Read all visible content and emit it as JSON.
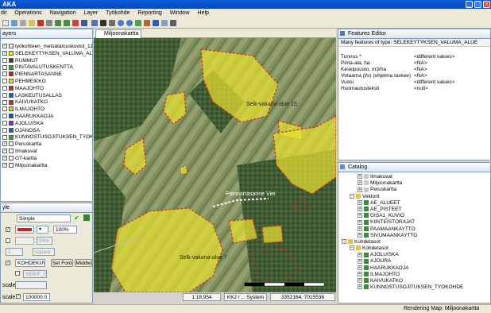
{
  "window": {
    "title": "AKA",
    "min": "_",
    "max": "□",
    "close": "x"
  },
  "menu": [
    "dit",
    "Operations",
    "Navigation",
    "Layer",
    "Työkohde",
    "Reporting",
    "Window",
    "Help"
  ],
  "layers_panel": {
    "title": "ayers",
    "items": [
      {
        "label": "työkohteen_metsätalouskuviot_119073",
        "color": "#f4f4f4",
        "checked": true
      },
      {
        "label": "SELEKEYTYKSEN_VALUMA_ALUE",
        "color": "#f0f000",
        "checked": true
      },
      {
        "label": "RUMMUT",
        "color": "#3a3a3a",
        "checked": false
      },
      {
        "label": "PINTAVALUTUSKENTTA",
        "color": "#28a828",
        "checked": false
      },
      {
        "label": "PIENNARTASANNE",
        "color": "#c02020",
        "checked": false
      },
      {
        "label": "PEHMEIKKO",
        "color": "#e8e020",
        "checked": false
      },
      {
        "label": "MAAJOHTO",
        "color": "#e02020",
        "checked": false
      },
      {
        "label": "LASKEUTUSALLAS",
        "color": "#1060c8",
        "checked": false
      },
      {
        "label": "KAIVUKATKO",
        "color": "#d82020",
        "checked": false
      },
      {
        "label": "ILMAJOHTO",
        "color": "#d8d020",
        "checked": false
      },
      {
        "label": "HAARUKKAOJA",
        "color": "#2040d0",
        "checked": false
      },
      {
        "label": "AJOLUISKA",
        "color": "#8030c0",
        "checked": false
      },
      {
        "label": "OJANOSA",
        "color": "#2050e0",
        "checked": false
      },
      {
        "label": "KUNNOSTUSOJITUKSEN_TYOKOHDE",
        "color": "#40a040",
        "checked": false
      },
      {
        "label": "Peruskartta",
        "color": "#ffffff",
        "checked": true
      },
      {
        "label": "Ilmakuvat",
        "color": "#ffffff",
        "checked": true
      },
      {
        "label": "GT-kartta",
        "color": "#ffffff",
        "checked": true
      },
      {
        "label": "Miljoonakartta",
        "color": "#ffffff",
        "checked": true
      }
    ]
  },
  "style_panel": {
    "title": "yle",
    "style_select": "Simple",
    "fill_opacity": "100%",
    "stroke_opacity": "50%",
    "stroke_width": "1",
    "square_select": "square",
    "label_field": "KOHDEKUVAL",
    "set_font": "Set Font",
    "middle": "Middle",
    "font_field": "SERIF_0",
    "scale_label_1": "scale:",
    "scale_label_2": "scale:",
    "max_scale": "100000.0"
  },
  "map_tab": {
    "title": "Miljoonakartta"
  },
  "map_labels": {
    "area_1": "Selk-valuma-alue 15",
    "area_2": "Piennartasanne Viei",
    "area_3": "Selk-valuma-alue 7"
  },
  "map_status": {
    "scale": "1:18,954",
    "crs": "KKJ / ... System",
    "coords": "3352164, 7015536"
  },
  "features_panel": {
    "title": "Features Editor",
    "subtitle": "Many features of type: SELEKEYTYKSEN_VALUMA_ALUE",
    "rows": [
      {
        "key": "Tunnus *",
        "value": "<different values>"
      },
      {
        "key": "Pinta-ala, ha",
        "value": "<NA>"
      },
      {
        "key": "Keskipuusto, m3/ha",
        "value": "<NA>"
      },
      {
        "key": "Virtaama (l/s) (ohjelma laskee)",
        "value": "<NA>"
      },
      {
        "key": "Vuosi",
        "value": "<different values>"
      },
      {
        "key": "Huomautusteksti",
        "value": "<null>"
      }
    ]
  },
  "catalog_panel": {
    "title": "Catalog",
    "items": [
      {
        "label": "Ilmakuvat",
        "indent": 2,
        "kind": "leaf"
      },
      {
        "label": "Miljoonakartta",
        "indent": 2,
        "kind": "leaf"
      },
      {
        "label": "Peruskartta",
        "indent": 2,
        "kind": "leaf"
      },
      {
        "label": "Vektorit",
        "indent": 1,
        "kind": "folder"
      },
      {
        "label": "AE_ALUEET",
        "indent": 2,
        "kind": "vector"
      },
      {
        "label": "AE_PISTEET",
        "indent": 2,
        "kind": "vector"
      },
      {
        "label": "GISA1_KUVIO",
        "indent": 2,
        "kind": "vector"
      },
      {
        "label": "KIINTEISTORAJAT",
        "indent": 2,
        "kind": "vector"
      },
      {
        "label": "PAAMAANKAYTTO",
        "indent": 2,
        "kind": "vector"
      },
      {
        "label": "SIVUMAANKAYTTO",
        "indent": 2,
        "kind": "vector"
      },
      {
        "label": "Kohdetasot",
        "indent": 0,
        "kind": "folder"
      },
      {
        "label": "Kohdetasot",
        "indent": 1,
        "kind": "folder"
      },
      {
        "label": "AJOLUISKA",
        "indent": 2,
        "kind": "vector"
      },
      {
        "label": "AJOURA",
        "indent": 2,
        "kind": "vector"
      },
      {
        "label": "HAARUKKAOJA",
        "indent": 2,
        "kind": "vector"
      },
      {
        "label": "ILMAJOHTO",
        "indent": 2,
        "kind": "vector"
      },
      {
        "label": "KAIVUKATKO",
        "indent": 2,
        "kind": "vector"
      },
      {
        "label": "KUNNOSTUSOJITUKSEN_TYOKOHDE",
        "indent": 2,
        "kind": "vector"
      }
    ]
  },
  "statusbar": {
    "text": "Rendering Map: Miljoonakartta"
  }
}
